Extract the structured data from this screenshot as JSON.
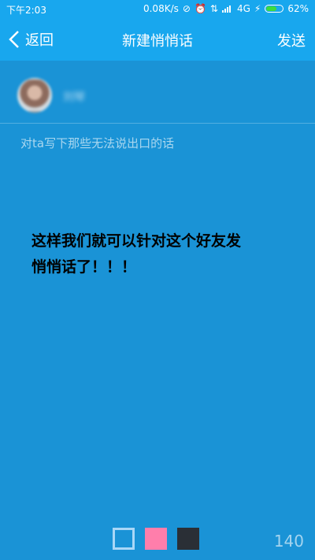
{
  "status_bar": {
    "time": "下午2:03",
    "speed": "0.08K/s",
    "network": "4G",
    "battery_text": "62%",
    "battery_level": 0.62,
    "battery_fill_color": "#3ddc3d"
  },
  "nav": {
    "back_label": "返回",
    "title": "新建悄悄话",
    "send_label": "发送"
  },
  "recipient": {
    "name": "刘琴"
  },
  "composer": {
    "placeholder": "对ta写下那些无法说出口的话",
    "caption": "这样我们就可以针对这个好友发悄悄话了！！！"
  },
  "footer": {
    "colors": [
      "#1a93d6",
      "#ff7eab",
      "#2a2f36"
    ],
    "char_count": "140"
  },
  "theme": {
    "background": "#1a93d6",
    "header": "#18a7ee"
  }
}
